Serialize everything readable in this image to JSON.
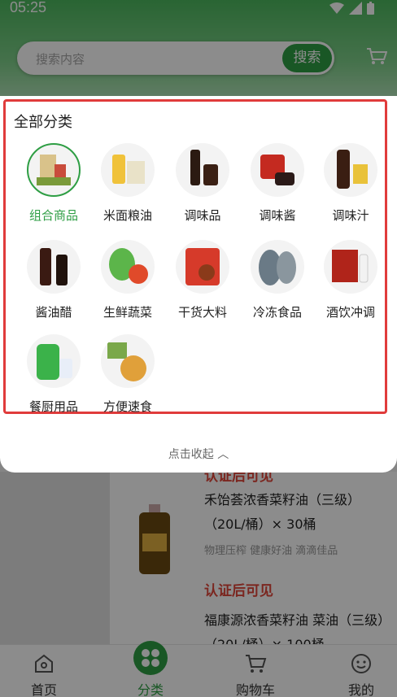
{
  "status_bar": {
    "time": "05:25"
  },
  "search": {
    "placeholder": "搜索内容",
    "button": "搜索"
  },
  "panel": {
    "title": "全部分类",
    "categories": [
      {
        "label": "组合商品",
        "icon": "combo-goods-icon",
        "selected": true
      },
      {
        "label": "米面粮油",
        "icon": "rice-oil-icon"
      },
      {
        "label": "调味品",
        "icon": "seasoning-icon"
      },
      {
        "label": "调味酱",
        "icon": "sauce-icon"
      },
      {
        "label": "调味汁",
        "icon": "seasoning-juice-icon"
      },
      {
        "label": "酱油醋",
        "icon": "soy-vinegar-icon"
      },
      {
        "label": "生鲜蔬菜",
        "icon": "vegetables-icon"
      },
      {
        "label": "干货大料",
        "icon": "dry-spices-icon"
      },
      {
        "label": "冷冻食品",
        "icon": "frozen-food-icon"
      },
      {
        "label": "酒饮冲调",
        "icon": "drinks-icon"
      },
      {
        "label": "餐厨用品",
        "icon": "kitchen-supplies-icon"
      },
      {
        "label": "方便速食",
        "icon": "instant-food-icon"
      }
    ],
    "collapse_label": "点击收起 ︿"
  },
  "products": [
    {
      "tag": "认证后可见",
      "name": "禾饴荟浓香菜籽油（三级）（20L/桶）× 30桶",
      "desc": "物理压榨 健康好油 滴滴佳品"
    },
    {
      "tag": "认证后可见",
      "name": "福康源浓香菜籽油 菜油（三级）（20L/桶）× 100桶"
    }
  ],
  "bottom_nav": [
    {
      "label": "首页",
      "icon": "home-icon"
    },
    {
      "label": "分类",
      "icon": "category-icon",
      "active": true
    },
    {
      "label": "购物车",
      "icon": "cart-icon"
    },
    {
      "label": "我的",
      "icon": "profile-icon"
    }
  ],
  "colors": {
    "brand": "#2e9e44",
    "highlight_border": "#e03b3b",
    "tag_red": "#e0463a"
  }
}
